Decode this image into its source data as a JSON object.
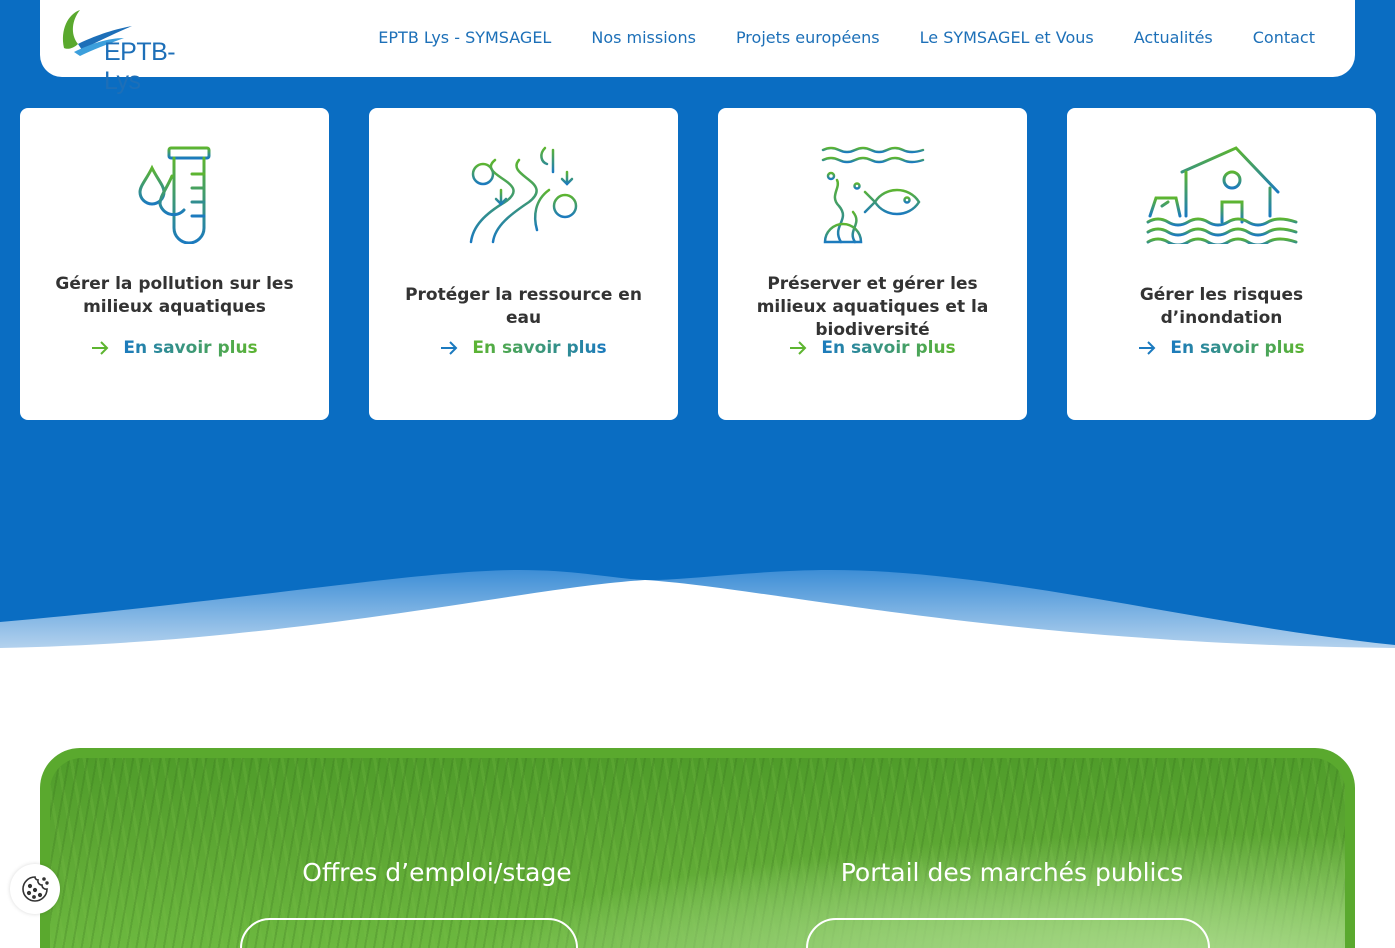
{
  "header": {
    "logo_text": "EPTB-Lys",
    "nav": [
      {
        "label": "EPTB Lys - SYMSAGEL"
      },
      {
        "label": "Nos missions"
      },
      {
        "label": "Projets européens"
      },
      {
        "label": "Le SYMSAGEL et Vous"
      },
      {
        "label": "Actualités"
      },
      {
        "label": "Contact"
      }
    ]
  },
  "missions": [
    {
      "icon": "test-tube-drops-icon",
      "title": "Gérer la pollution sur les milieux aquatiques",
      "link": "En savoir plus"
    },
    {
      "icon": "river-trees-icon",
      "title": "Protéger la ressource en eau",
      "link": "En savoir plus"
    },
    {
      "icon": "fish-seaweed-icon",
      "title": "Préserver et gérer les milieux aquatiques et la biodiversité",
      "link": "En savoir plus"
    },
    {
      "icon": "flooded-house-icon",
      "title": "Gérer les risques d’inondation",
      "link": "En savoir plus"
    }
  ],
  "opportunities": {
    "jobs_title": "Offres d’emploi/stage",
    "markets_title": "Portail des marchés publics"
  },
  "colors": {
    "primary_blue": "#0a6dc2",
    "link_blue": "#1d70b8",
    "brand_green": "#5aa92e"
  }
}
